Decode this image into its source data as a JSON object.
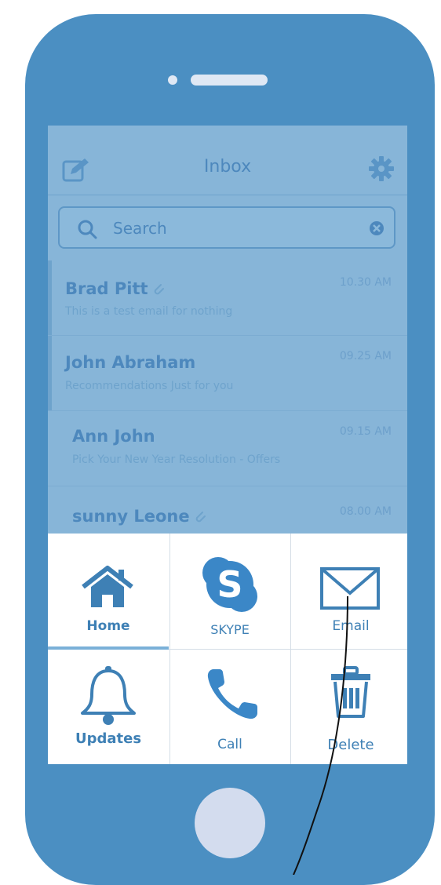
{
  "nav": {
    "title": "Inbox",
    "compose_icon": "compose-icon",
    "settings_icon": "gear-icon"
  },
  "search": {
    "placeholder": "Search",
    "icon": "search-icon",
    "clear_icon": "clear-icon"
  },
  "emails": [
    {
      "sender": "Brad Pitt",
      "time": "10.30 AM",
      "snippet": "This is a test email for nothing",
      "has_attachment": true
    },
    {
      "sender": "John Abraham",
      "time": "09.25 AM",
      "snippet": "Recommendations Just for you",
      "has_attachment": false
    },
    {
      "sender": "Ann John",
      "time": "09.15 AM",
      "snippet": "Pick Your New Year Resolution - Offers",
      "has_attachment": false
    },
    {
      "sender": "sunny Leone",
      "time": "08.00 AM",
      "snippet": "",
      "has_attachment": true
    }
  ],
  "actions": [
    {
      "label": "Home",
      "icon": "home-icon",
      "active": true
    },
    {
      "label": "SKYPE",
      "icon": "skype-icon",
      "active": false
    },
    {
      "label": "Email",
      "icon": "envelope-icon",
      "active": false
    },
    {
      "label": "Updates",
      "icon": "bell-icon",
      "active": false
    },
    {
      "label": "Call",
      "icon": "phone-icon",
      "active": false
    },
    {
      "label": "Delete",
      "icon": "trash-icon",
      "active": false
    }
  ],
  "colors": {
    "phone_body": "#4b8fc2",
    "screen_overlay": "#87b5d8",
    "action_text": "#3e80b5",
    "sheet_background": "#ffffff"
  }
}
